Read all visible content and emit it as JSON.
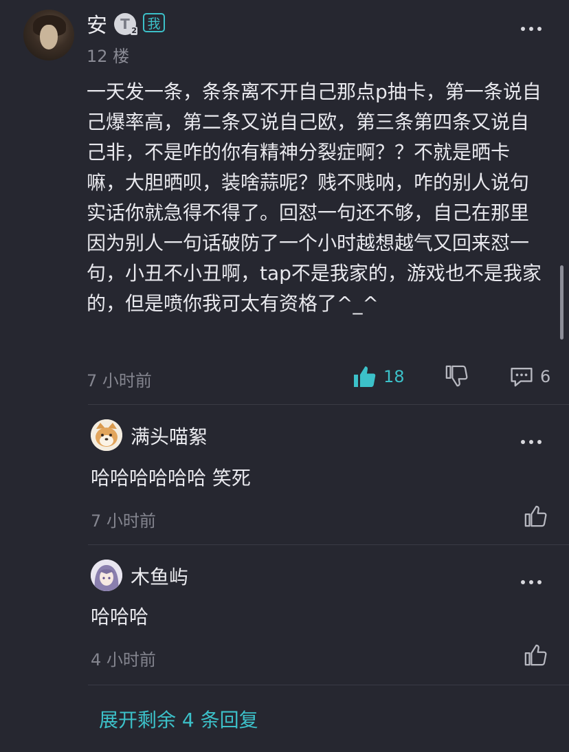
{
  "post": {
    "username": "安",
    "level_badge": "T",
    "level_sub": "2",
    "me_badge": "我",
    "floor": "12 楼",
    "content": "一天发一条，条条离不开自己那点p抽卡，第一条说自己爆率高，第二条又说自己欧，第三条第四条又说自己非，不是咋的你有精神分裂症啊？？不就是晒卡嘛，大胆晒呗，装啥蒜呢？贱不贱呐，咋的别人说句实话你就急得不得了。回怼一句还不够，自己在那里因为别人一句话破防了一个小时越想越气又回来怼一句，小丑不小丑啊，tap不是我家的，游戏也不是我家的，但是喷你我可太有资格了^_^",
    "time": "7 小时前",
    "likes": "18",
    "replies": "6"
  },
  "replies": [
    {
      "username": "满头喵絮",
      "text": "哈哈哈哈哈哈 笑死",
      "time": "7 小时前"
    },
    {
      "username": "木鱼屿",
      "text": "哈哈哈",
      "time": "4 小时前"
    }
  ],
  "expand_label": "展开剩余 4 条回复",
  "colors": {
    "background": "#262730",
    "accent": "#3cc1c9",
    "muted_text": "#84858f",
    "primary_text": "#e9e9ee"
  },
  "icons": {
    "more": "more-dots-icon",
    "like": "thumbs-up-icon",
    "dislike": "thumbs-down-icon",
    "comment": "comment-icon"
  }
}
